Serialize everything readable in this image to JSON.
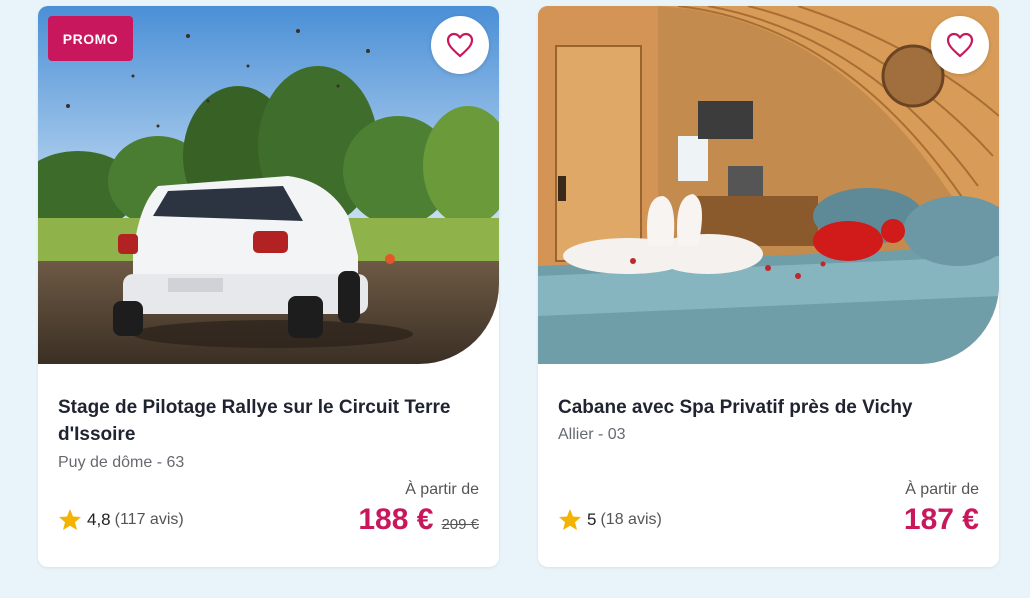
{
  "cards": [
    {
      "badge": "PROMO",
      "title": "Stage de Pilotage Rallye sur le Circuit Terre d'Issoire",
      "location": "Puy de dôme - 63",
      "rating": "4,8",
      "reviews": "(117 avis)",
      "from_label": "À partir de",
      "price": "188 €",
      "old_price": "209 €",
      "image_icon": "rally-car-photo",
      "favorite_icon": "heart-outline-icon"
    },
    {
      "title": "Cabane avec Spa Privatif près de Vichy",
      "location": "Allier - 03",
      "rating": "5",
      "reviews": "(18 avis)",
      "from_label": "À partir de",
      "price": "187 €",
      "image_icon": "wooden-cabin-bedroom-photo",
      "favorite_icon": "heart-outline-icon"
    }
  ],
  "colors": {
    "accent": "#c8175d",
    "star": "#f5b301",
    "background": "#e8f4f9"
  }
}
